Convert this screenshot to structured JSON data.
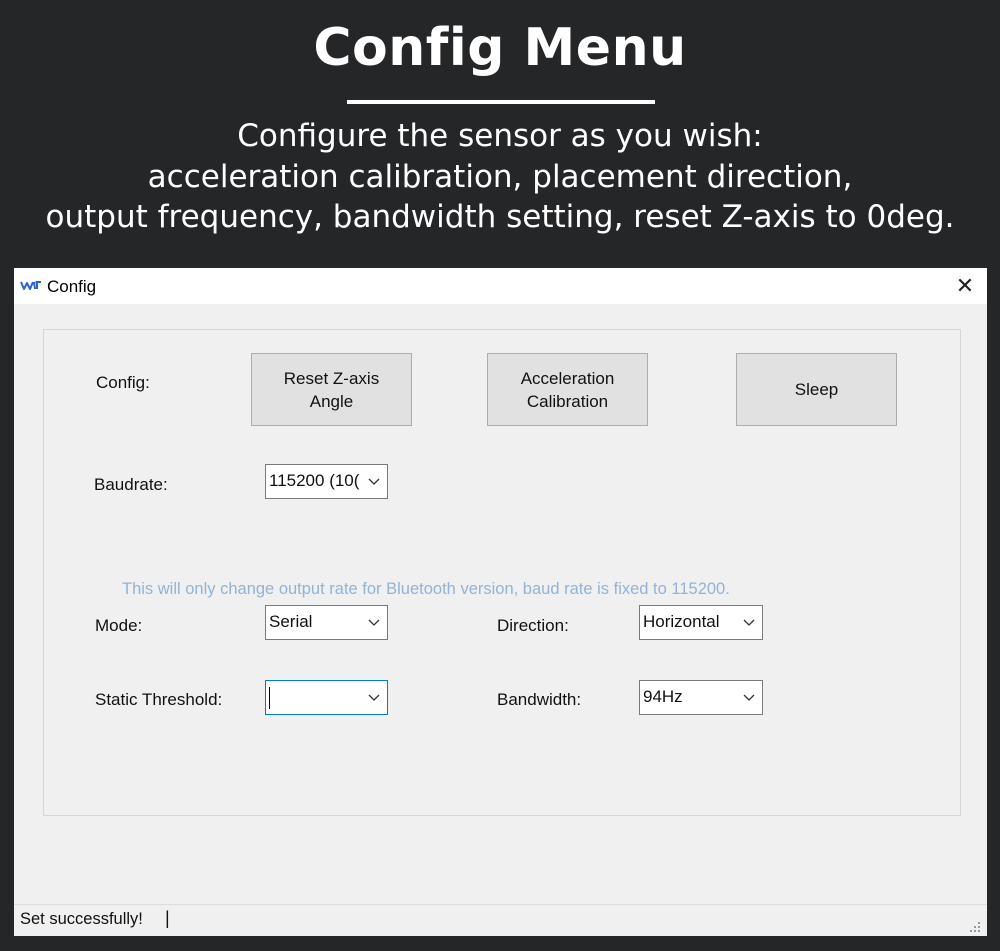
{
  "hero": {
    "title": "Config Menu",
    "subtitle_lines": [
      "Configure the sensor as you wish:",
      "acceleration calibration, placement direction,",
      "output frequency, bandwidth setting, reset Z-axis to 0deg."
    ]
  },
  "window": {
    "title": "Config",
    "close_glyph": "✕",
    "app_icon": "wit-logo-icon"
  },
  "config": {
    "label": "Config:",
    "buttons": {
      "reset_line1": "Reset Z-axis",
      "reset_line2": "Angle",
      "accel_line1": "Acceleration",
      "accel_line2": "Calibration",
      "sleep": "Sleep"
    }
  },
  "baudrate": {
    "label": "Baudrate:",
    "value": "115200 (10(",
    "hint": "This will only change output rate for Bluetooth version, baud rate is fixed to 115200."
  },
  "mode": {
    "label": "Mode:",
    "value": "Serial"
  },
  "direction": {
    "label": "Direction:",
    "value": "Horizontal"
  },
  "static_threshold": {
    "label": "Static Threshold:",
    "value": ""
  },
  "bandwidth": {
    "label": "Bandwidth:",
    "value": "94Hz"
  },
  "status": {
    "text": "Set successfully!",
    "separator": "|"
  },
  "colors": {
    "page_bg": "#252628",
    "window_bg": "#f0f0f0",
    "hint_text": "#92b3d6",
    "focus_border": "#0078d7"
  }
}
